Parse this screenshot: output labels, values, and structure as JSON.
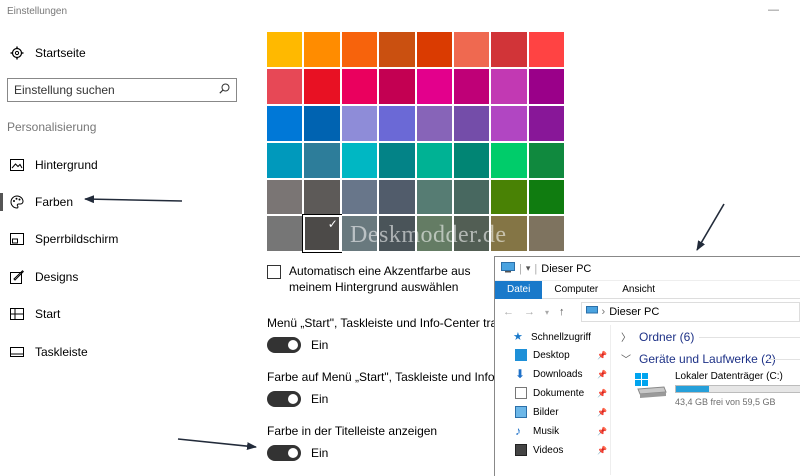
{
  "window": {
    "title": "Einstellungen",
    "minimize_glyph": "—"
  },
  "sidebar": {
    "home": "Startseite",
    "search_placeholder": "Einstellung suchen",
    "section": "Personalisierung",
    "items": [
      {
        "label": "Hintergrund",
        "icon": "image-icon"
      },
      {
        "label": "Farben",
        "icon": "palette-icon",
        "selected": true
      },
      {
        "label": "Sperrbildschirm",
        "icon": "lockscreen-icon"
      },
      {
        "label": "Designs",
        "icon": "designs-icon"
      },
      {
        "label": "Start",
        "icon": "start-icon"
      },
      {
        "label": "Taskleiste",
        "icon": "taskbar-icon"
      }
    ]
  },
  "colors": {
    "swatches": [
      "#ffb900",
      "#ff8c00",
      "#f7630c",
      "#ca5010",
      "#da3b01",
      "#ef6950",
      "#d13438",
      "#ff4343",
      "#e74856",
      "#e81123",
      "#ea005e",
      "#c30052",
      "#e3008c",
      "#bf0077",
      "#c239b3",
      "#9a0089",
      "#0078d7",
      "#0063b1",
      "#8e8cd8",
      "#6b69d6",
      "#8764b8",
      "#744da9",
      "#b146c2",
      "#881798",
      "#0099bc",
      "#2d7d9a",
      "#00b7c3",
      "#038387",
      "#00b294",
      "#018574",
      "#00cc6a",
      "#10893e",
      "#7a7574",
      "#5d5a58",
      "#68768a",
      "#515c6b",
      "#567c73",
      "#486860",
      "#498205",
      "#107c10",
      "#767676",
      "#4c4a48",
      "#69797e",
      "#4a5459",
      "#647c64",
      "#525e54",
      "#847545",
      "#7e735f"
    ],
    "selected_index": 41,
    "watermark": "Deskmodder.de",
    "auto_accent": {
      "label": "Automatisch eine Akzentfarbe aus meinem Hintergrund auswählen",
      "checked": false
    },
    "options": [
      {
        "label": "Menü „Start\", Taskleiste und Info-Center transparent machen",
        "state": "Ein"
      },
      {
        "label": "Farbe auf Menü „Start\", Taskleiste und Info-Center anzeigen",
        "state": "Ein"
      },
      {
        "label": "Farbe in der Titelleiste anzeigen",
        "state": "Ein"
      }
    ]
  },
  "explorer": {
    "title": "Dieser PC",
    "tabs": [
      "Datei",
      "Computer",
      "Ansicht"
    ],
    "address": "Dieser PC",
    "quick_access": "Schnellzugriff",
    "nav_items": [
      "Desktop",
      "Downloads",
      "Dokumente",
      "Bilder",
      "Musik",
      "Videos"
    ],
    "group_folders": "Ordner (6)",
    "group_drives": "Geräte und Laufwerke (2)",
    "drive": {
      "name": "Lokaler Datenträger (C:)",
      "free": "43,4 GB frei von 59,5 GB",
      "used_fraction": 0.27
    },
    "accent": "#1979ca"
  }
}
